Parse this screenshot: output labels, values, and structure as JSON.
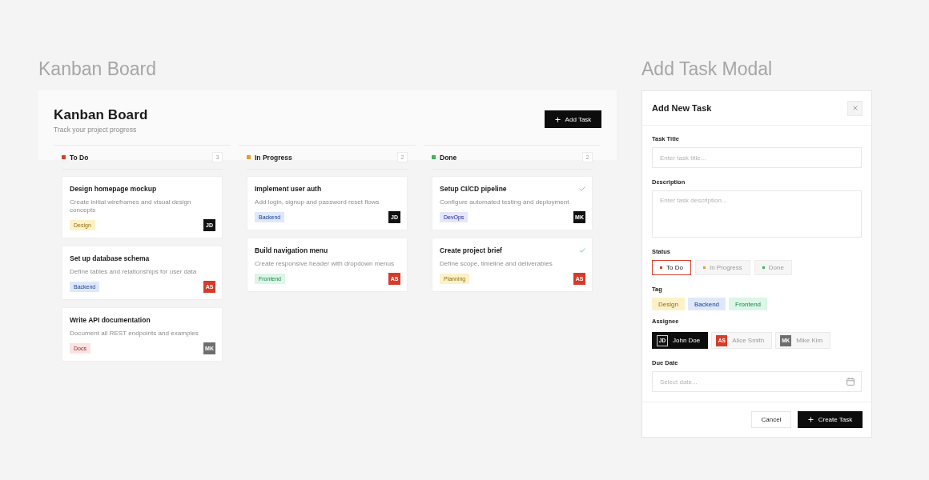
{
  "board_label": "Kanban Board",
  "modal_label": "Add Task Modal",
  "board": {
    "title": "Kanban Board",
    "subtitle": "Track your project progress",
    "add_button": "Add Task",
    "columns": [
      {
        "name": "To Do",
        "color": "#d9412b",
        "count": "3",
        "cards": [
          {
            "title": "Design homepage mockup",
            "description": "Create initial wireframes and visual design concepts",
            "tag": {
              "label": "Design",
              "color": "#fdf1c8"
            },
            "assignee": {
              "initials": "JD",
              "color": "#111111"
            },
            "completed": false
          },
          {
            "title": "Set up database schema",
            "description": "Define tables and relationships for user data",
            "tag": {
              "label": "Backend",
              "color": "#dfe8fb"
            },
            "assignee": {
              "initials": "AS",
              "color": "#d63b2a"
            },
            "completed": false
          },
          {
            "title": "Write API documentation",
            "description": "Document all REST endpoints and examples",
            "tag": {
              "label": "Docs",
              "color": "#fbe3e3"
            },
            "assignee": {
              "initials": "MK",
              "color": "#6e6e6e"
            },
            "completed": false
          }
        ]
      },
      {
        "name": "In Progress",
        "color": "#e99b2d",
        "count": "2",
        "cards": [
          {
            "title": "Implement user auth",
            "description": "Add login, signup and password reset flows",
            "tag": {
              "label": "Backend",
              "color": "#dfe8fb"
            },
            "assignee": {
              "initials": "JD",
              "color": "#111111"
            },
            "completed": false
          },
          {
            "title": "Build navigation menu",
            "description": "Create responsive header with dropdown menus",
            "tag": {
              "label": "Frontend",
              "color": "#dcf6e8"
            },
            "assignee": {
              "initials": "AS",
              "color": "#d63b2a"
            },
            "completed": false
          }
        ]
      },
      {
        "name": "Done",
        "color": "#43b35c",
        "count": "2",
        "cards": [
          {
            "title": "Setup CI/CD pipeline",
            "description": "Configure automated testing and deployment",
            "tag": {
              "label": "DevOps",
              "color": "#e5e6fb"
            },
            "assignee": {
              "initials": "MK",
              "color": "#111111"
            },
            "completed": true
          },
          {
            "title": "Create project brief",
            "description": "Define scope, timeline and deliverables",
            "tag": {
              "label": "Planning",
              "color": "#fdf1c8"
            },
            "assignee": {
              "initials": "AS",
              "color": "#d63b2a"
            },
            "completed": true
          }
        ]
      }
    ]
  },
  "modal": {
    "title": "Add New Task",
    "fields": [
      {
        "kind": "text",
        "label": "Task Title",
        "placeholder": "Enter task title..."
      },
      {
        "kind": "textarea",
        "label": "Description",
        "placeholder": "Enter task description..."
      },
      {
        "kind": "status",
        "label": "Status",
        "options": [
          {
            "label": "To Do",
            "color": "#d9412b",
            "selected": true
          },
          {
            "label": "In Progress",
            "color": "#e99b2d",
            "selected": false
          },
          {
            "label": "Done",
            "color": "#43b35c",
            "selected": false
          }
        ]
      },
      {
        "kind": "tag",
        "label": "Tag",
        "options": [
          {
            "label": "Design",
            "color": "#fdf1c8",
            "selected": false
          },
          {
            "label": "Backend",
            "color": "#dfe8fb",
            "selected": false
          },
          {
            "label": "Frontend",
            "color": "#dcf6e8",
            "selected": false
          }
        ]
      },
      {
        "kind": "assignee",
        "label": "Assignee",
        "options": [
          {
            "name": "John Doe",
            "initials": "JD",
            "color": "#111111",
            "selected": true
          },
          {
            "name": "Alice Smith",
            "initials": "AS",
            "color": "#d63b2a",
            "selected": false
          },
          {
            "name": "Mike Kim",
            "initials": "MK",
            "color": "#6e6e6e",
            "selected": false
          }
        ]
      },
      {
        "kind": "date",
        "label": "Due Date",
        "placeholder": "Select date..."
      }
    ],
    "buttons": [
      {
        "kind": "secondary",
        "label": "Cancel"
      },
      {
        "kind": "primary",
        "label": "Create Task"
      }
    ]
  }
}
